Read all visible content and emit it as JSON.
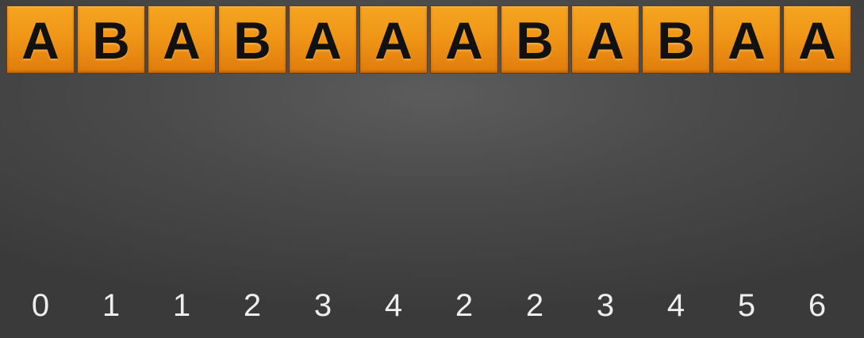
{
  "tiles": [
    "A",
    "B",
    "A",
    "B",
    "A",
    "A",
    "A",
    "B",
    "A",
    "B",
    "A",
    "A"
  ],
  "values": [
    "0",
    "1",
    "1",
    "2",
    "3",
    "4",
    "2",
    "2",
    "3",
    "4",
    "5",
    "6"
  ],
  "colors": {
    "tile": "#ef9517",
    "tile_border": "#6a3a06",
    "letter": "#111111",
    "background": "#4a4a4a",
    "number": "#eeeeee"
  }
}
